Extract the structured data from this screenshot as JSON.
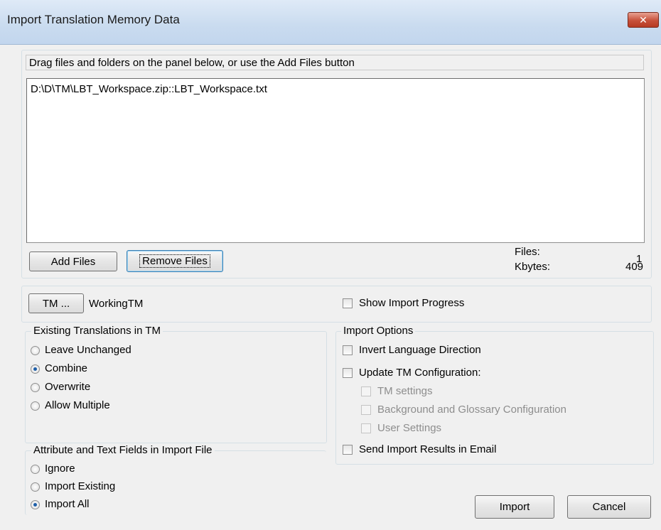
{
  "window": {
    "title": "Import Translation Memory Data",
    "close_glyph": "✕"
  },
  "files": {
    "instructions": "Drag files and folders on the panel below, or use the Add Files button",
    "list": [
      "D:\\D\\TM\\LBT_Workspace.zip::LBT_Workspace.txt"
    ],
    "add_button": "Add Files",
    "remove_button": "Remove Files",
    "files_label": "Files:",
    "files_count": "1",
    "kbytes_label": "Kbytes:",
    "kbytes_value": "409"
  },
  "tm": {
    "button": "TM ...",
    "name": "WorkingTM"
  },
  "show_progress": {
    "label": "Show Import Progress",
    "checked": false
  },
  "existing": {
    "title": "Existing Translations in TM",
    "options": [
      {
        "label": "Leave Unchanged",
        "checked": false
      },
      {
        "label": "Combine",
        "checked": true
      },
      {
        "label": "Overwrite",
        "checked": false
      },
      {
        "label": "Allow Multiple",
        "checked": false
      }
    ]
  },
  "attributes": {
    "title": "Attribute and Text Fields in Import File",
    "options": [
      {
        "label": "Ignore",
        "checked": false
      },
      {
        "label": "Import Existing",
        "checked": false
      },
      {
        "label": "Import All",
        "checked": true
      }
    ]
  },
  "import_options": {
    "title": "Import Options",
    "invert": "Invert Language Direction",
    "update_config": "Update TM Configuration:",
    "tm_settings": "TM settings",
    "background_glossary": "Background and Glossary Configuration",
    "user_settings": "User Settings",
    "send_email": "Send Import Results in Email"
  },
  "actions": {
    "import": "Import",
    "cancel": "Cancel"
  }
}
